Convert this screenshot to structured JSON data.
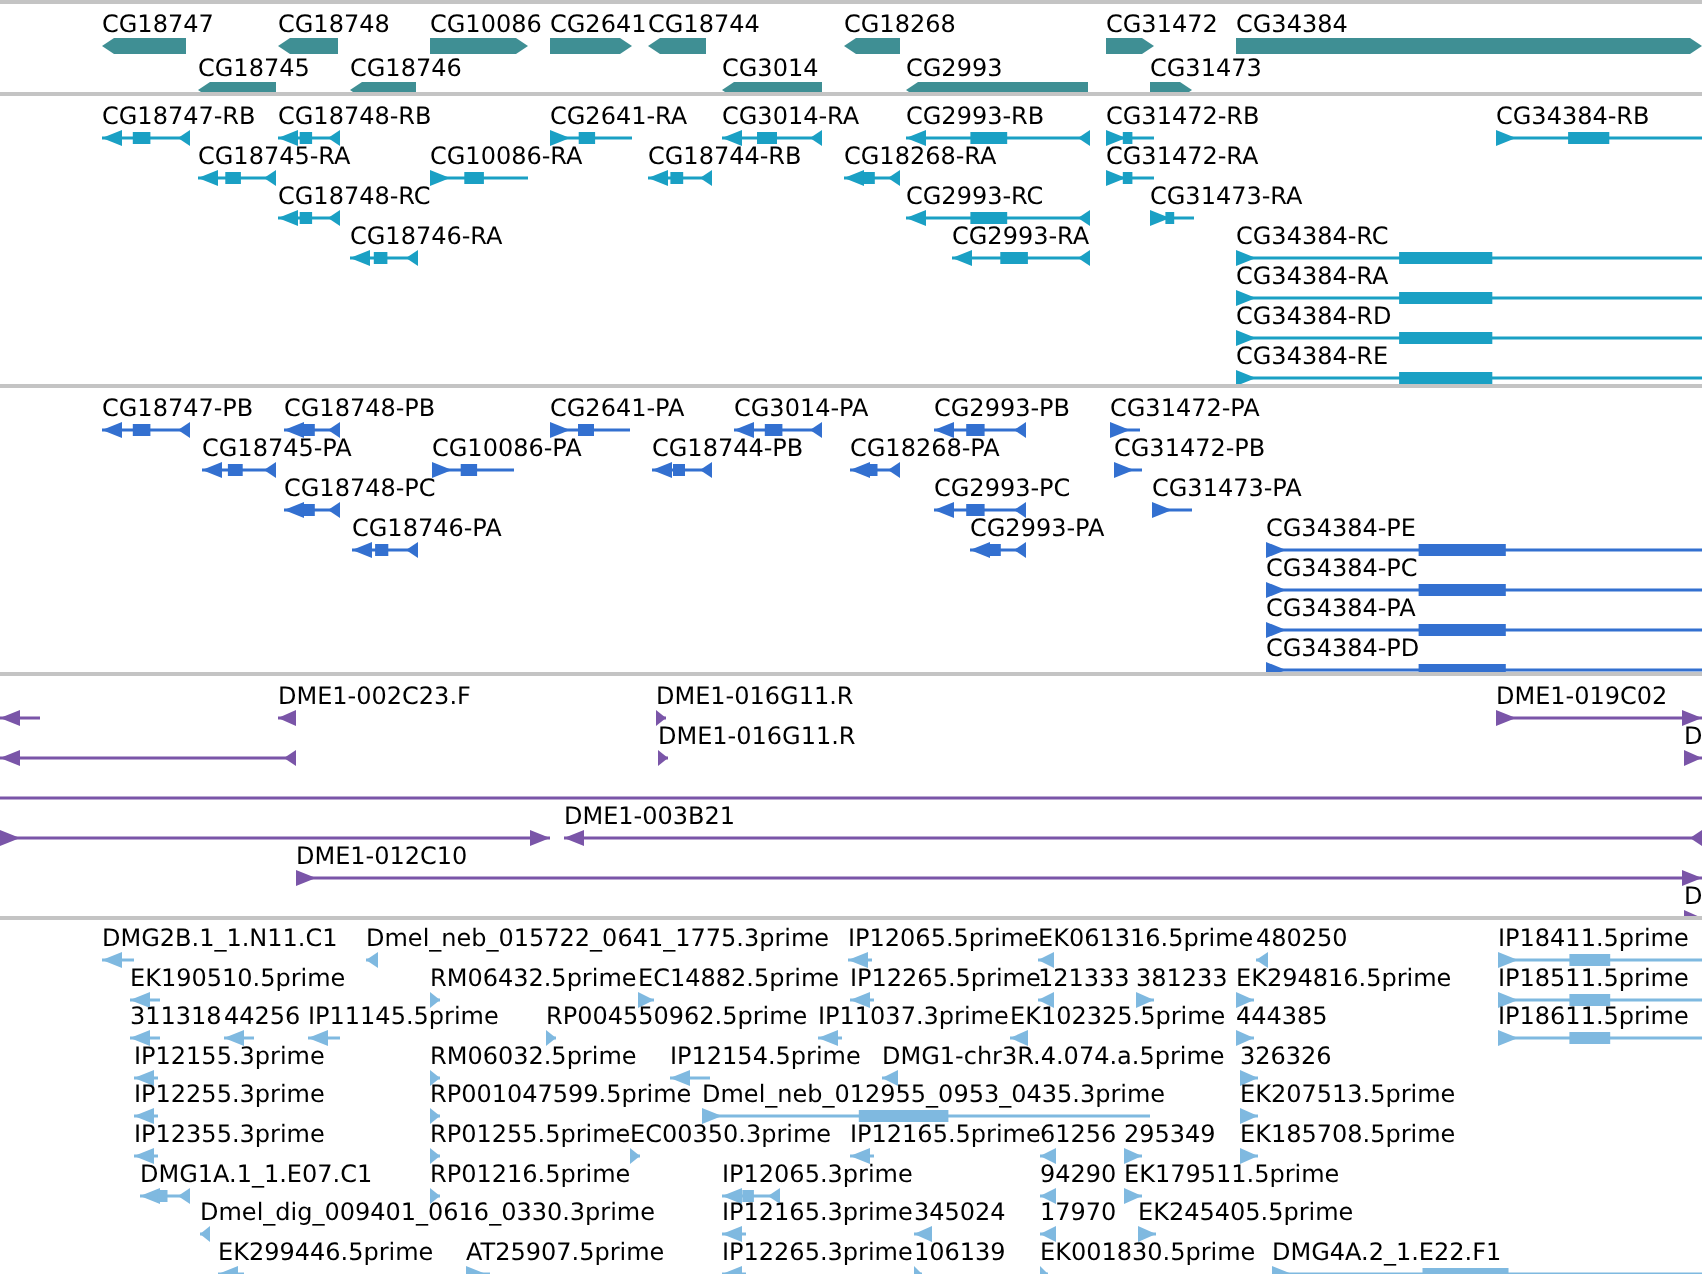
{
  "tracks": [
    {
      "kind": "gene",
      "rows": [
        {
          "features": [
            {
              "label": "CG18747"
            },
            {
              "label": "CG18748"
            },
            {
              "label": "CG10086"
            },
            {
              "label": "CG2641"
            },
            {
              "label": "CG18744"
            },
            {
              "label": "CG18268"
            },
            {
              "label": "CG31472"
            },
            {
              "label": "CG34384"
            }
          ]
        },
        {
          "features": [
            {
              "label": "CG18745"
            },
            {
              "label": "CG18746"
            },
            {
              "label": "CG3014"
            },
            {
              "label": "CG2993"
            },
            {
              "label": "CG31473"
            }
          ]
        }
      ]
    },
    {
      "kind": "transcript",
      "rows": [
        {
          "features": [
            {
              "label": "CG18747-RB"
            },
            {
              "label": "CG18748-RB"
            },
            {
              "label": "CG2641-RA"
            },
            {
              "label": "CG3014-RA"
            },
            {
              "label": "CG2993-RB"
            },
            {
              "label": "CG31472-RB"
            },
            {
              "label": "CG34384-RB"
            }
          ]
        },
        {
          "features": [
            {
              "label": "CG18745-RA"
            },
            {
              "label": "CG10086-RA"
            },
            {
              "label": "CG18744-RB"
            },
            {
              "label": "CG18268-RA"
            },
            {
              "label": "CG31472-RA"
            }
          ]
        },
        {
          "features": [
            {
              "label": "CG18748-RC"
            },
            {
              "label": "CG2993-RC"
            },
            {
              "label": "CG31473-RA"
            }
          ]
        },
        {
          "features": [
            {
              "label": "CG18746-RA"
            },
            {
              "label": "CG2993-RA"
            },
            {
              "label": "CG34384-RC"
            }
          ]
        },
        {
          "features": [
            {
              "label": "CG34384-RA"
            }
          ]
        },
        {
          "features": [
            {
              "label": "CG34384-RD"
            }
          ]
        },
        {
          "features": [
            {
              "label": "CG34384-RE"
            }
          ]
        }
      ]
    },
    {
      "kind": "protein",
      "rows": [
        {
          "features": [
            {
              "label": "CG18747-PB"
            },
            {
              "label": "CG18748-PB"
            },
            {
              "label": "CG2641-PA"
            },
            {
              "label": "CG3014-PA"
            },
            {
              "label": "CG2993-PB"
            },
            {
              "label": "CG31472-PA"
            }
          ]
        },
        {
          "features": [
            {
              "label": "CG18745-PA"
            },
            {
              "label": "CG10086-PA"
            },
            {
              "label": "CG18744-PB"
            },
            {
              "label": "CG18268-PA"
            },
            {
              "label": "CG31472-PB"
            }
          ]
        },
        {
          "features": [
            {
              "label": "CG18748-PC"
            },
            {
              "label": "CG2993-PC"
            },
            {
              "label": "CG31473-PA"
            }
          ]
        },
        {
          "features": [
            {
              "label": "CG18746-PA"
            },
            {
              "label": "CG2993-PA"
            },
            {
              "label": "CG34384-PE"
            }
          ]
        },
        {
          "features": [
            {
              "label": "CG34384-PC"
            }
          ]
        },
        {
          "features": [
            {
              "label": "CG34384-PA"
            }
          ]
        },
        {
          "features": [
            {
              "label": "CG34384-PD"
            }
          ]
        }
      ]
    },
    {
      "kind": "clone",
      "rows": [
        {
          "features": [
            {
              "label": "DME1-002C23.F"
            },
            {
              "label": "DME1-016G11.R"
            },
            {
              "label": "DME1-019C02"
            }
          ]
        },
        {
          "features": [
            {
              "label": "DME1-016G11.R"
            },
            {
              "label": "D"
            }
          ]
        },
        {
          "features": []
        },
        {
          "features": [
            {
              "label": "DME1-003B21"
            }
          ]
        },
        {
          "features": [
            {
              "label": "DME1-012C10"
            }
          ]
        },
        {
          "features": [
            {
              "label": "D"
            }
          ]
        }
      ]
    },
    {
      "kind": "est",
      "rows": [
        {
          "features": [
            {
              "label": "DMG2B.1_1.N11.C1"
            },
            {
              "label": "Dmel_neb_015722_0641_1775.3prime"
            },
            {
              "label": "IP12065.5prime"
            },
            {
              "label": "EK061316.5prime"
            },
            {
              "label": "480250"
            },
            {
              "label": "IP18411.5prime"
            }
          ]
        },
        {
          "features": [
            {
              "label": "EK190510.5prime"
            },
            {
              "label": "RM06432.5prime"
            },
            {
              "label": "EC14882.5prime"
            },
            {
              "label": "IP12265.5prime"
            },
            {
              "label": "121333"
            },
            {
              "label": "381233"
            },
            {
              "label": "EK294816.5prime"
            },
            {
              "label": "IP18511.5prime"
            }
          ]
        },
        {
          "features": [
            {
              "label": "311318"
            },
            {
              "label": "44256"
            },
            {
              "label": "IP11145.5prime"
            },
            {
              "label": "RP004550962.5prime"
            },
            {
              "label": "IP11037.3prime"
            },
            {
              "label": "EK102325.5prime"
            },
            {
              "label": "444385"
            },
            {
              "label": "IP18611.5prime"
            }
          ]
        },
        {
          "features": [
            {
              "label": "IP12155.3prime"
            },
            {
              "label": "RM06032.5prime"
            },
            {
              "label": "IP12154.5prime"
            },
            {
              "label": "DMG1-chr3R.4.074.a.5prime"
            },
            {
              "label": "326326"
            }
          ]
        },
        {
          "features": [
            {
              "label": "IP12255.3prime"
            },
            {
              "label": "RP001047599.5prime"
            },
            {
              "label": "Dmel_neb_012955_0953_0435.3prime"
            },
            {
              "label": "EK207513.5prime"
            }
          ]
        },
        {
          "features": [
            {
              "label": "IP12355.3prime"
            },
            {
              "label": "RP01255.5prime"
            },
            {
              "label": "EC00350.3prime"
            },
            {
              "label": "IP12165.5prime"
            },
            {
              "label": "61256"
            },
            {
              "label": "295349"
            },
            {
              "label": "EK185708.5prime"
            }
          ]
        },
        {
          "features": [
            {
              "label": "DMG1A.1_1.E07.C1"
            },
            {
              "label": "RP01216.5prime"
            },
            {
              "label": "IP12065.3prime"
            },
            {
              "label": "94290"
            },
            {
              "label": "EK179511.5prime"
            }
          ]
        },
        {
          "features": [
            {
              "label": "Dmel_dig_009401_0616_0330.3prime"
            },
            {
              "label": "IP12165.3prime"
            },
            {
              "label": "345024"
            },
            {
              "label": "17970"
            },
            {
              "label": "EK245405.5prime"
            }
          ]
        },
        {
          "features": [
            {
              "label": "EK299446.5prime"
            },
            {
              "label": "AT25907.5prime"
            },
            {
              "label": "IP12265.3prime"
            },
            {
              "label": "106139"
            },
            {
              "label": "EK001830.5prime"
            },
            {
              "label": "DMG4A.2_1.E22.F1"
            }
          ]
        }
      ]
    }
  ]
}
